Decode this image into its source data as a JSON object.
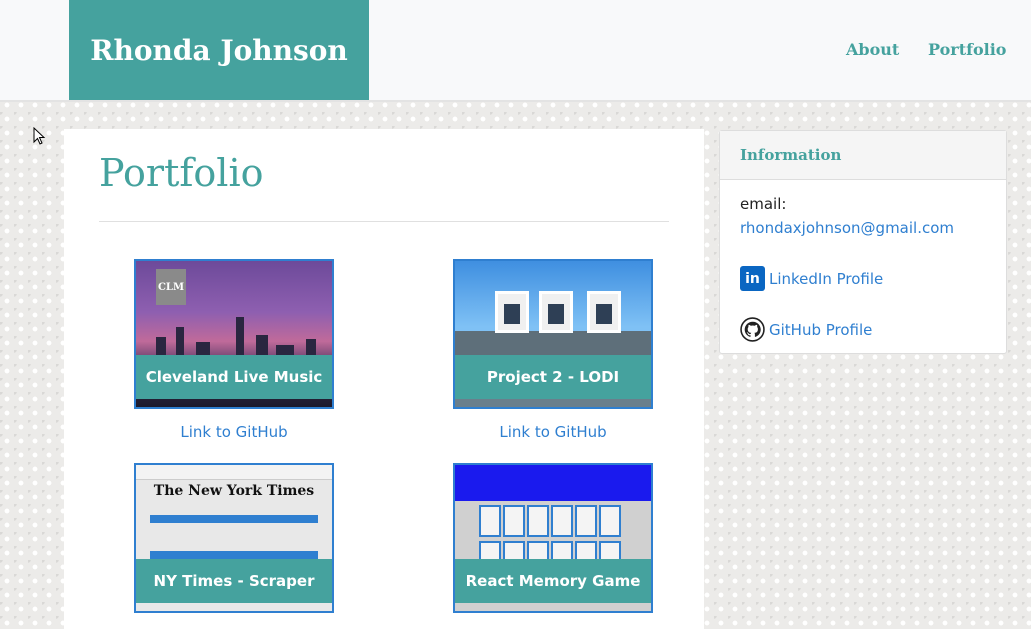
{
  "header": {
    "brand": "Rhonda Johnson",
    "nav": [
      {
        "label": "About"
      },
      {
        "label": "Portfolio"
      }
    ]
  },
  "main": {
    "title": "Portfolio",
    "projects": [
      {
        "title": "Cleveland Live Music",
        "link_text": "Link to GitHub",
        "thumb_badge": "CLM"
      },
      {
        "title": "Project 2 - LODI",
        "link_text": "Link to GitHub"
      },
      {
        "title": "NY Times - Scraper",
        "thumb_masthead": "The New York Times"
      },
      {
        "title": "React Memory Game"
      }
    ]
  },
  "sidebar": {
    "heading": "Information",
    "email_label": "email:",
    "email": "rhondaxjohnson@gmail.com",
    "linkedin_label": "LinkedIn Profile",
    "github_label": "GitHub Profile"
  },
  "colors": {
    "accent": "#45a29e",
    "link": "#2f7fd0",
    "linkedin": "#0a66c2"
  },
  "icons": [
    "linkedin-icon",
    "github-icon",
    "mouse-cursor-icon"
  ]
}
